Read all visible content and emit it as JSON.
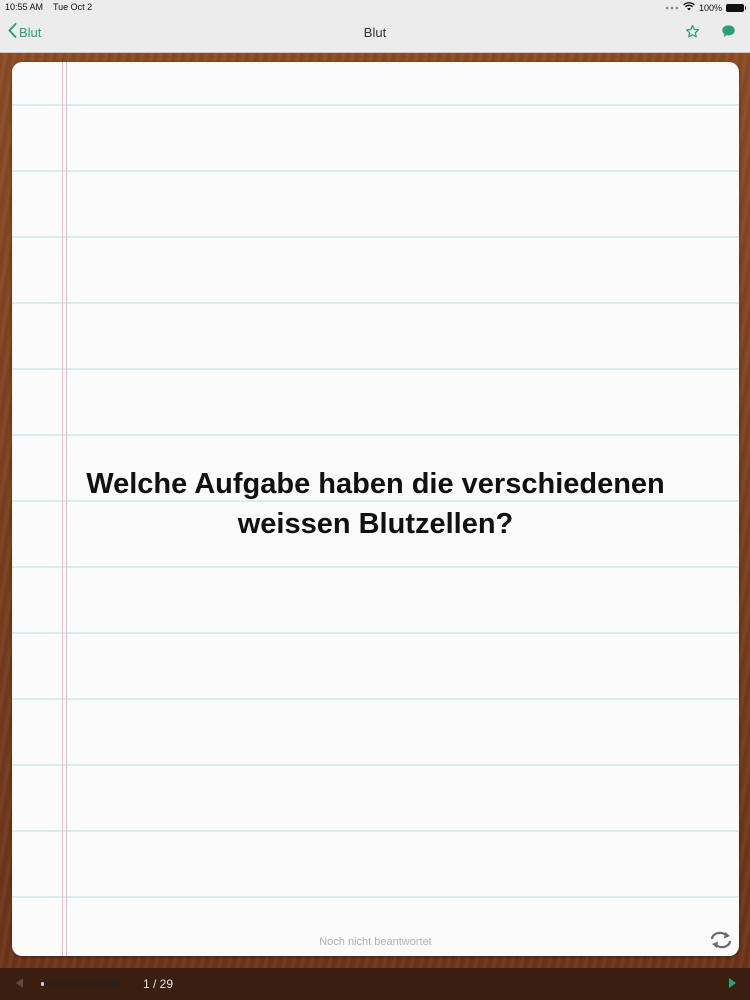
{
  "status_bar": {
    "time": "10:55 AM",
    "date": "Tue Oct 2",
    "battery": "100%"
  },
  "nav": {
    "back_label": "Blut",
    "title": "Blut",
    "star_icon": "star-icon",
    "chat_icon": "speech-bubble-icon"
  },
  "card": {
    "question_line1": "Welche Aufgabe haben die verschiedenen",
    "question_line2": "weissen Blutzellen?",
    "answer_status": "Noch nicht beantwortet",
    "flip_icon": "flip-icon"
  },
  "bottom_bar": {
    "page_indicator": "1 / 29",
    "progress_fraction": 0.034
  },
  "colors": {
    "accent": "#2aa07a",
    "wood": "#7a3f1e",
    "paper": "#fbfbfb",
    "rule_line": "#d6ecef",
    "margin_line": "#f1b8bd"
  }
}
